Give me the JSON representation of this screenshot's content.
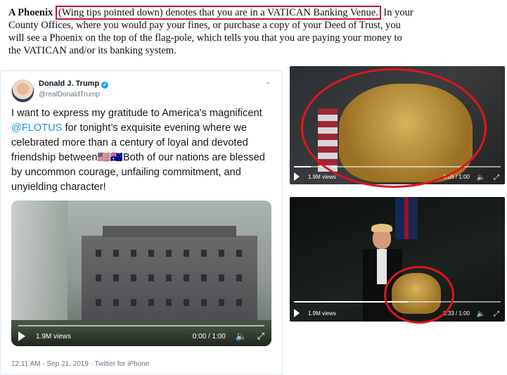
{
  "intro": {
    "lead": "A Phoenix",
    "highlight": "(Wing tips pointed down) denotes that you are in a VATICAN Banking Venue.",
    "rest": "In your County Offices, where you would pay your fines, or purchase a copy of your Deed of Trust, you will see a Phoenix on the top of the flag-pole, which tells you that you are paying your money to the VATICAN and/or its banking system."
  },
  "tweet": {
    "name": "Donald J. Trump",
    "verified_glyph": "✓",
    "handle": "@realDonaldTrump",
    "caret": "⌄",
    "text_before": "I want to express my gratitude to America’s magnificent ",
    "mention": "@FLOTUS",
    "text_after": " for tonight’s exquisite evening where we celebrated more than a century of loyal and devoted friendship between🇺🇸🇦🇺Both of our nations are blessed by uncommon courage, unfailing commitment, and unyielding character!",
    "video": {
      "views": "1.9M views",
      "time": "0:00 / 1:00",
      "volume_glyph": "🔈",
      "expand_glyph": "⤢"
    },
    "footer": "12:11 AM - Sep 21, 2019 · Twitter for iPhone"
  },
  "video_top": {
    "views": "1.9M views",
    "time": "0:05 / 1:00",
    "volume_glyph": "🔈",
    "expand_glyph": "⤢",
    "progress": 0.08
  },
  "video_bottom": {
    "views": "1.9M views",
    "time": "0:33 / 1:00",
    "volume_glyph": "🔈",
    "expand_glyph": "⤢",
    "progress": 0.55
  },
  "colors": {
    "highlight_box": "#c8102e",
    "ring": "#e0141d",
    "mention": "#1b95e0"
  }
}
